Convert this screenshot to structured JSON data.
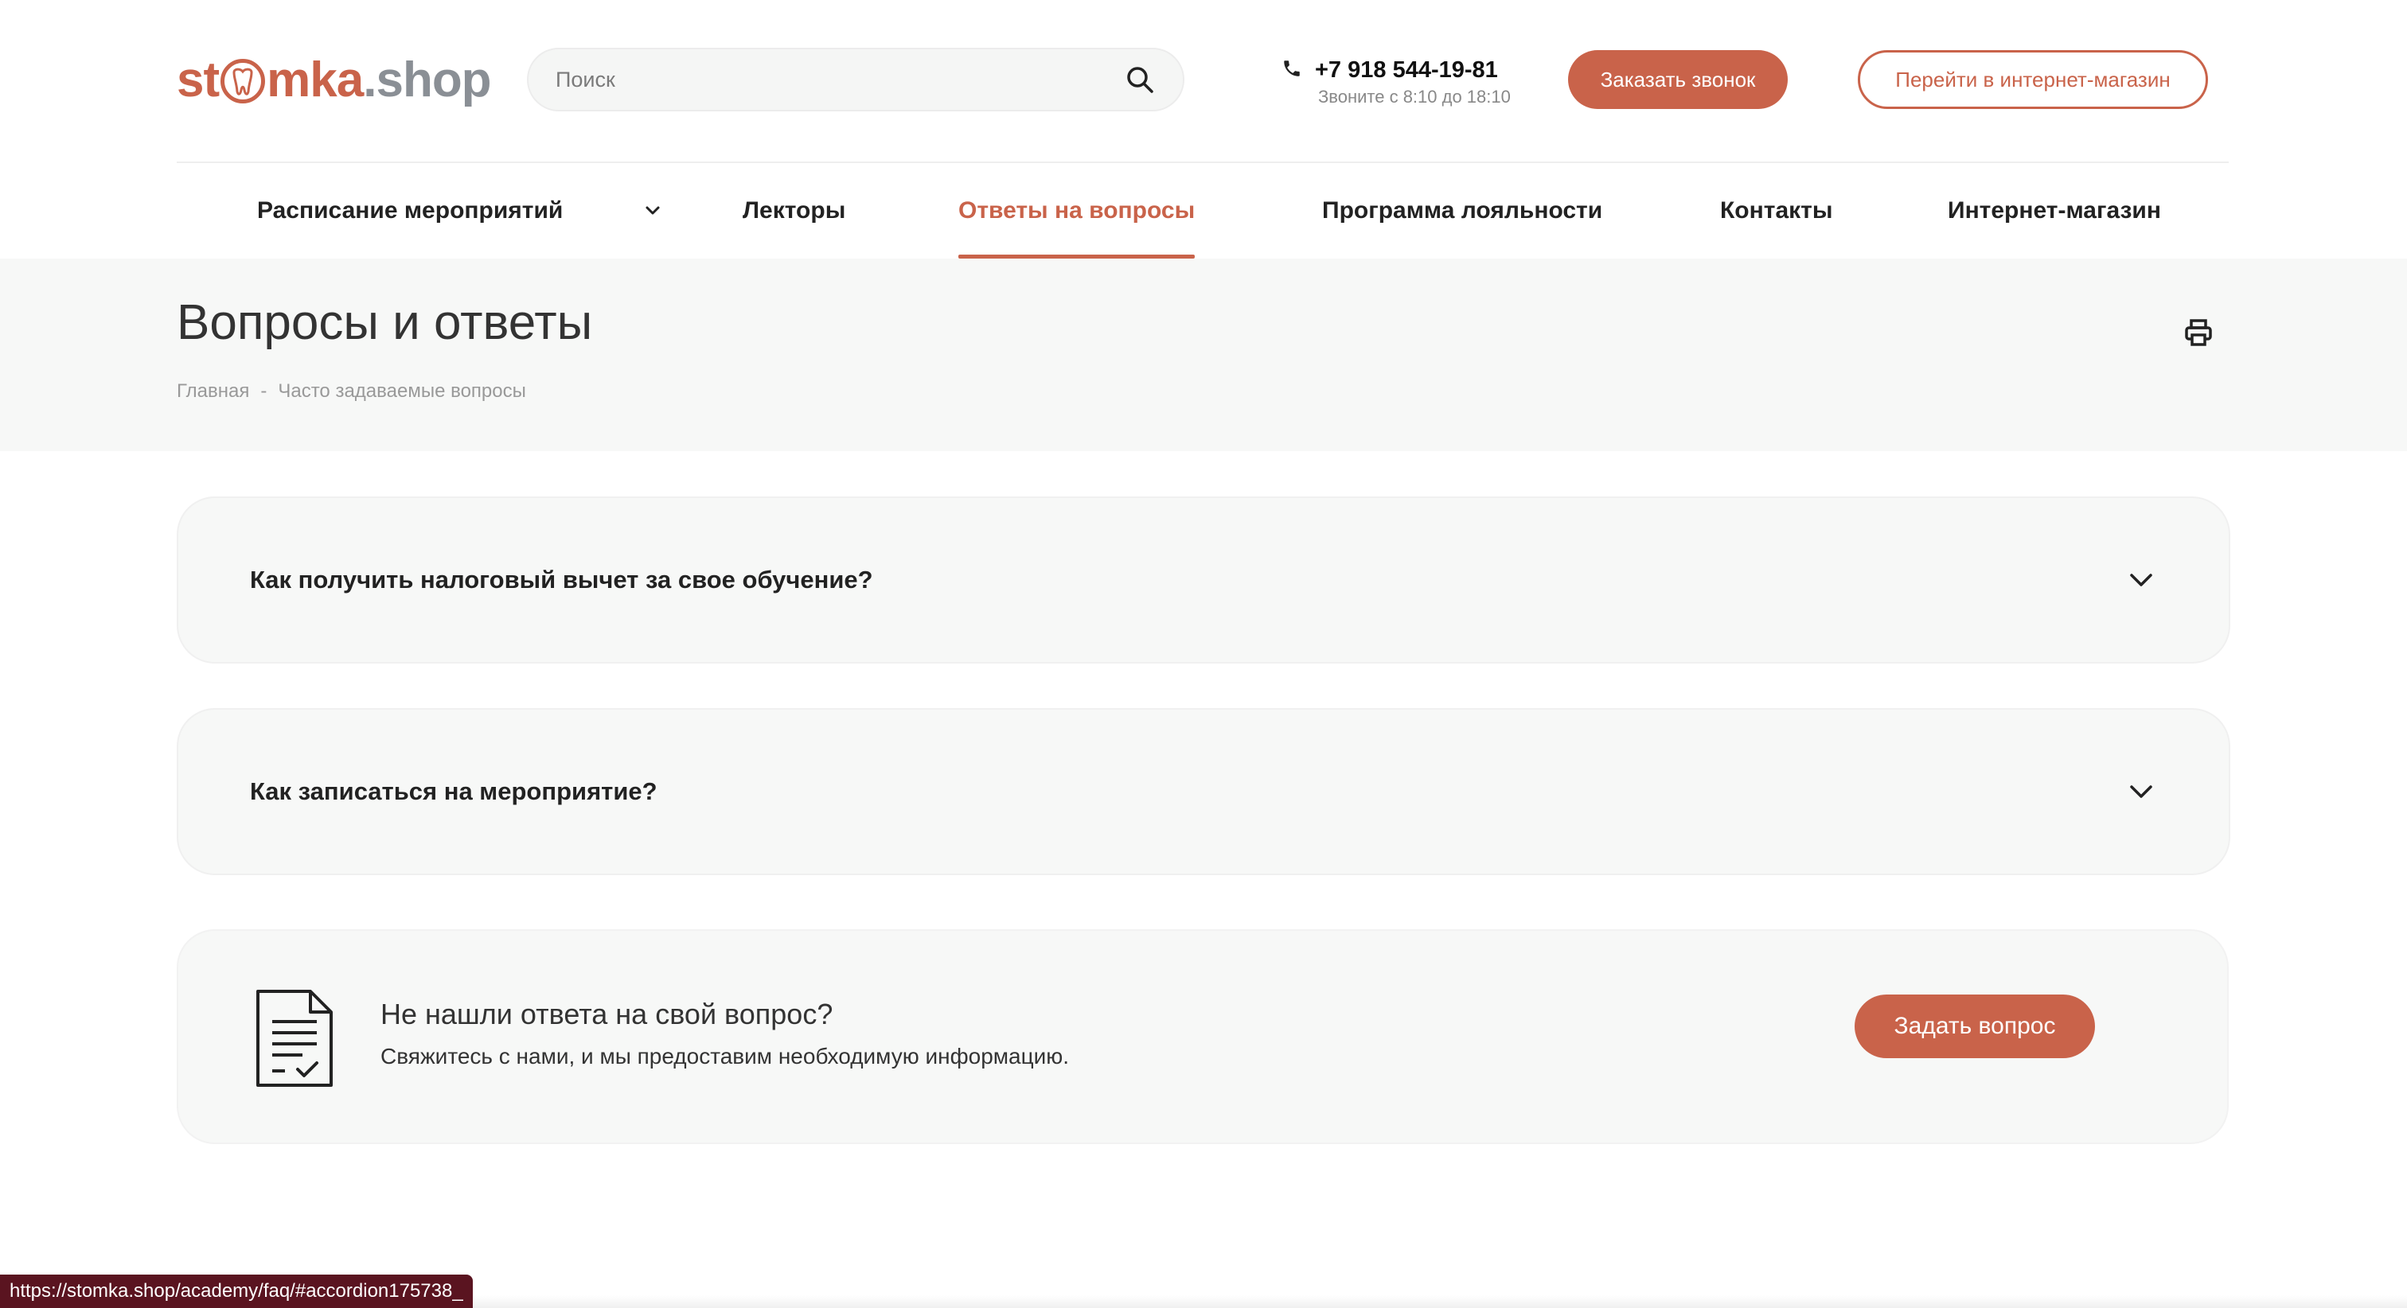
{
  "header": {
    "logo": {
      "part1": "st",
      "part2": "mka",
      "part3": ".shop"
    },
    "search": {
      "placeholder": "Поиск"
    },
    "phone": {
      "number": "+7 918 544-19-81",
      "hours": "Звоните с 8:10 до 18:10"
    },
    "call_button": "Заказать звонок",
    "shop_button": "Перейти в интернет-магазин"
  },
  "nav": {
    "items": [
      {
        "label": "Расписание мероприятий"
      },
      {
        "label": "Лекторы"
      },
      {
        "label": "Ответы на вопросы",
        "active": true
      },
      {
        "label": "Программа лояльности"
      },
      {
        "label": "Контакты"
      },
      {
        "label": "Интернет-магазин"
      }
    ]
  },
  "page": {
    "title": "Вопросы и ответы",
    "breadcrumb": {
      "home": "Главная",
      "separator": "-",
      "current": "Часто задаваемые вопросы"
    }
  },
  "faq": [
    {
      "question": "Как получить налоговый вычет за свое обучение?"
    },
    {
      "question": "Как записаться на мероприятие?"
    }
  ],
  "cta": {
    "title": "Не нашли ответа на свой вопрос?",
    "subtitle": "Свяжитесь с нами, и мы предоставим необходимую информацию.",
    "button": "Задать вопрос"
  },
  "status_bar": {
    "url": "https://stomka.shop/academy/faq/#accordion175738_"
  },
  "colors": {
    "accent": "#c9634a",
    "logo_gray": "#8a8f95",
    "band": "#f7f8f7"
  }
}
